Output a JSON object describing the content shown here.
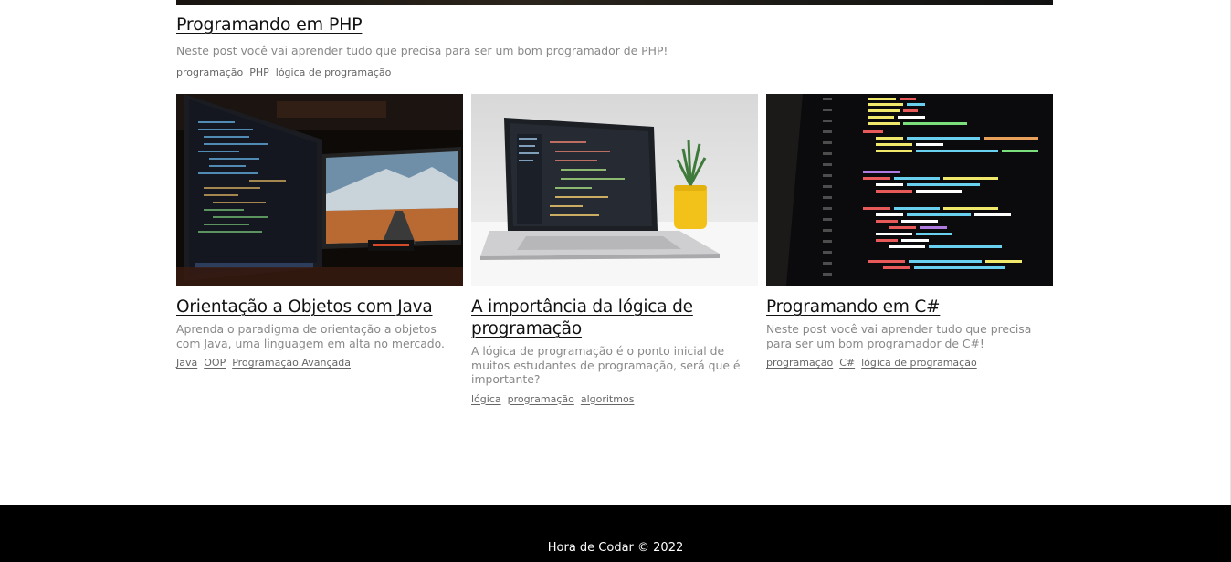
{
  "hero": {
    "title": "Programando em PHP",
    "description": "Neste post você vai aprender tudo que precisa para ser um bom programador de PHP!",
    "tags": [
      "programação",
      "PHP",
      "lógica de programação"
    ]
  },
  "cards": [
    {
      "title": "Orientação a Objetos com Java",
      "description": "Aprenda o paradigma de orientação a objetos com Java, uma linguagem em alta no mercado.",
      "tags": [
        "Java",
        "OOP",
        "Programação Avançada"
      ]
    },
    {
      "title": "A importância da lógica de programação",
      "description": "A lógica de programação é o ponto inicial de muitos estudantes de programação, será que é importante?",
      "tags": [
        "lógica",
        "programação",
        "algoritmos"
      ]
    },
    {
      "title": "Programando em C#",
      "description": "Neste post você vai aprender tudo que precisa para ser um bom programador de C#!",
      "tags": [
        "programação",
        "C#",
        "lógica de programação"
      ]
    }
  ],
  "footer": {
    "text": "Hora de Codar © 2022"
  }
}
